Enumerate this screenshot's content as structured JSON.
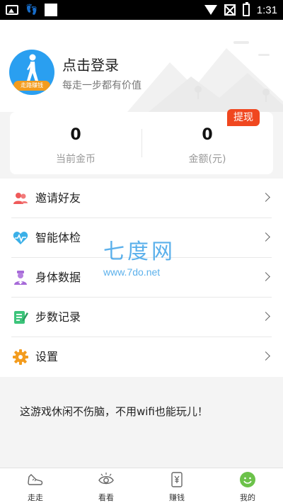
{
  "status_bar": {
    "time": "1:31"
  },
  "profile": {
    "avatar_badge": "走路赚钱",
    "login_title": "点击登录",
    "subtitle": "每走一步都有价值"
  },
  "stats": {
    "coins_value": "0",
    "coins_label": "当前金币",
    "amount_value": "0",
    "amount_label": "金额(元)",
    "withdraw_label": "提现"
  },
  "menu": {
    "items": [
      {
        "label": "邀请好友",
        "icon": "people-icon"
      },
      {
        "label": "智能体检",
        "icon": "heartbeat-icon"
      },
      {
        "label": "身体数据",
        "icon": "nurse-icon"
      },
      {
        "label": "步数记录",
        "icon": "notebook-icon"
      },
      {
        "label": "设置",
        "icon": "gear-icon"
      }
    ]
  },
  "watermark": {
    "big": "七度网",
    "small": "www.7do.net"
  },
  "tagline": "这游戏休闲不伤脑，不用wifi也能玩儿！",
  "bottom_nav": {
    "items": [
      {
        "label": "走走",
        "icon": "shoe-icon"
      },
      {
        "label": "看看",
        "icon": "eye-icon"
      },
      {
        "label": "赚钱",
        "icon": "money-icon"
      },
      {
        "label": "我的",
        "icon": "smile-icon",
        "active": true
      }
    ]
  },
  "colors": {
    "accent_blue": "#2a9ff0",
    "withdraw_red": "#f0471f",
    "active_green": "#6cc24a",
    "badge_orange": "#f39c1e"
  }
}
